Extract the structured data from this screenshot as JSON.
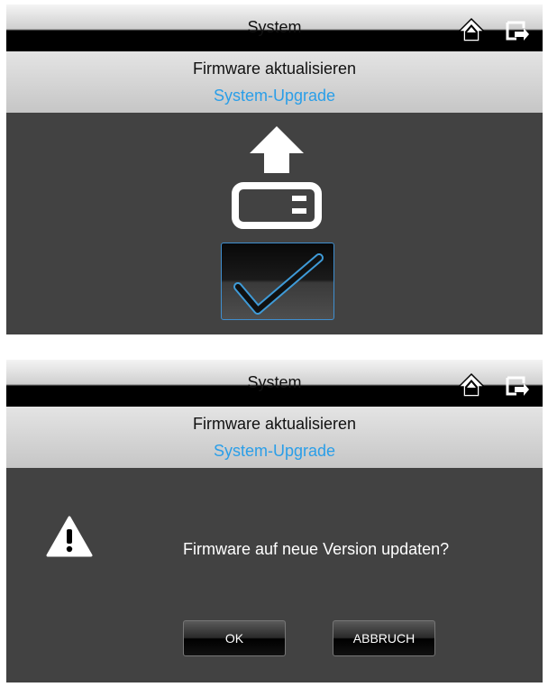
{
  "screen_upgrade": {
    "header": {
      "title": "System",
      "home_icon": "home-icon",
      "exit_icon": "exit-icon"
    },
    "subheader": {
      "title": "Firmware aktualisieren",
      "subtitle": "System-Upgrade"
    },
    "upgrade_icon": "upload-to-device-icon",
    "confirm_icon": "checkmark-icon",
    "colors": {
      "accent": "#2a9ee8",
      "background": "#424242",
      "header_bg": "#000000"
    }
  },
  "screen_dialog": {
    "header": {
      "title": "System",
      "home_icon": "home-icon",
      "exit_icon": "exit-icon"
    },
    "subheader": {
      "title": "Firmware aktualisieren",
      "subtitle": "System-Upgrade"
    },
    "warning_icon": "warning-icon",
    "message": "Firmware auf neue Version updaten?",
    "ok_label": "OK",
    "cancel_label": "ABBRUCH"
  }
}
